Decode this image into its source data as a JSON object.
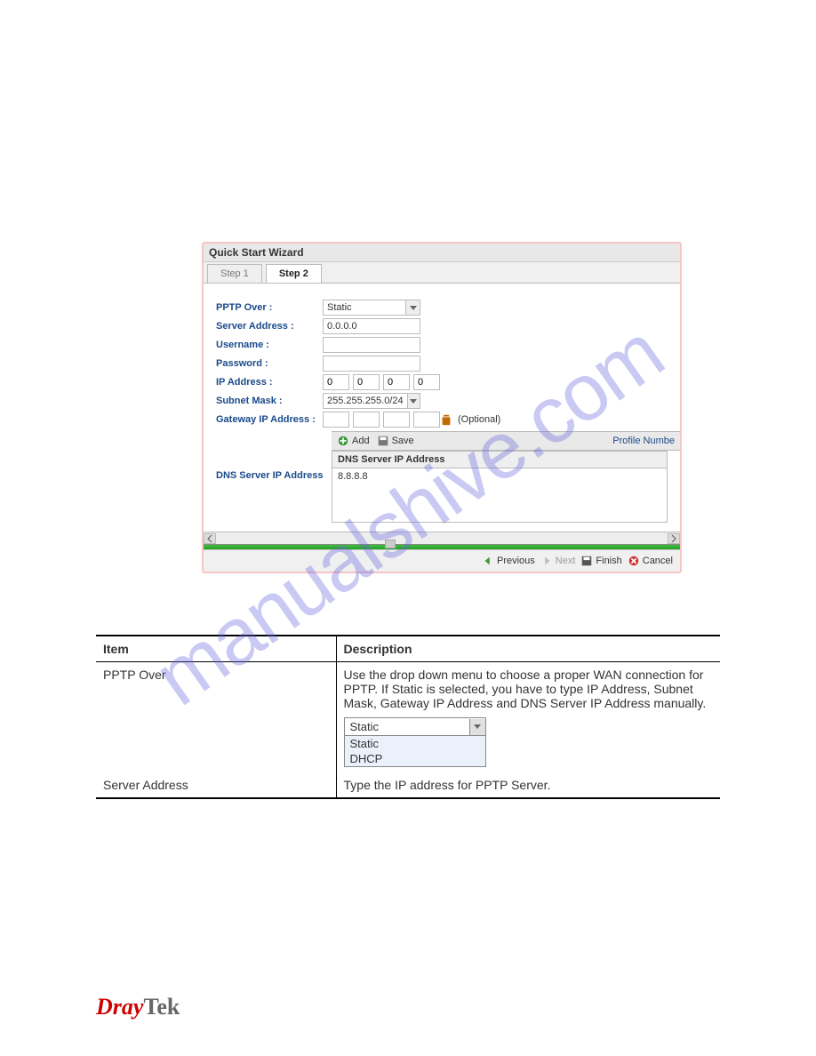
{
  "watermark": "manualshive.com",
  "wizard": {
    "title": "Quick Start Wizard",
    "tabs": [
      "Step 1",
      "Step 2"
    ],
    "activeTab": 1,
    "labels": {
      "pptp_over": "PPTP Over :",
      "server_address": "Server Address :",
      "username": "Username :",
      "password": "Password :",
      "ip_address": "IP Address :",
      "subnet_mask": "Subnet Mask :",
      "gateway": "Gateway IP Address :",
      "optional": "(Optional)",
      "dns_left": "DNS Server IP Address",
      "dns_th": "DNS Server IP Address"
    },
    "values": {
      "pptp_over": "Static",
      "server_address": "0.0.0.0",
      "username": "",
      "password": "",
      "ip": [
        "0",
        "0",
        "0",
        "0"
      ],
      "subnet": "255.255.255.0/24",
      "gateway": [
        "",
        "",
        "",
        ""
      ],
      "dns_value": "8.8.8.8"
    },
    "toolbar": {
      "add": "Add",
      "save": "Save",
      "profile_number": "Profile Numbe"
    },
    "footer": {
      "previous": "Previous",
      "next": "Next",
      "finish": "Finish",
      "cancel": "Cancel"
    }
  },
  "desc": {
    "head_item": "Item",
    "head_desc": "Description",
    "row1_item": "PPTP Over",
    "row1_desc": "Use the drop down menu to choose a proper WAN connection for PPTP. If Static is selected, you have to type IP Address, Subnet Mask, Gateway IP Address and DNS Server IP Address manually.",
    "select_value": "Static",
    "select_options": [
      "Static",
      "DHCP"
    ],
    "row2_item": "Server Address",
    "row2_desc": "Type the IP address for PPTP Server."
  },
  "brand": {
    "d": "Dray",
    "t": "Tek"
  }
}
